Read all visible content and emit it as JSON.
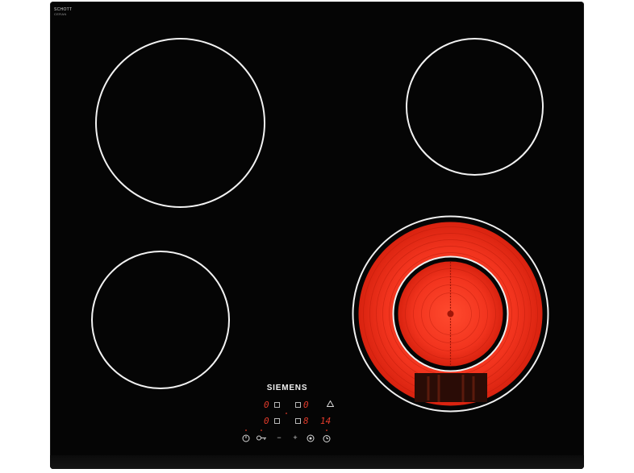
{
  "brand": {
    "glass_brand": "SCHOTT",
    "glass_name": "CERAN",
    "logo": "SIEMENS"
  },
  "controls": {
    "row1_left_digit": "0",
    "row1_right_digit": "0",
    "row2_left_digit": "0",
    "row2_mid_digit": "8",
    "timer_value": "14",
    "power_icon": "power-icon",
    "lock_icon": "key-lock-icon",
    "minus_symbol": "−",
    "plus_symbol": "+",
    "zone_select_icon": "zone-select-icon",
    "timer_icon": "timer-icon",
    "warning_icon": "triangle-icon"
  },
  "colors": {
    "glass": "#050505",
    "zone_outline": "#f2f2f2",
    "heat_red": "#f2341e",
    "display_red": "#e23b2b"
  }
}
